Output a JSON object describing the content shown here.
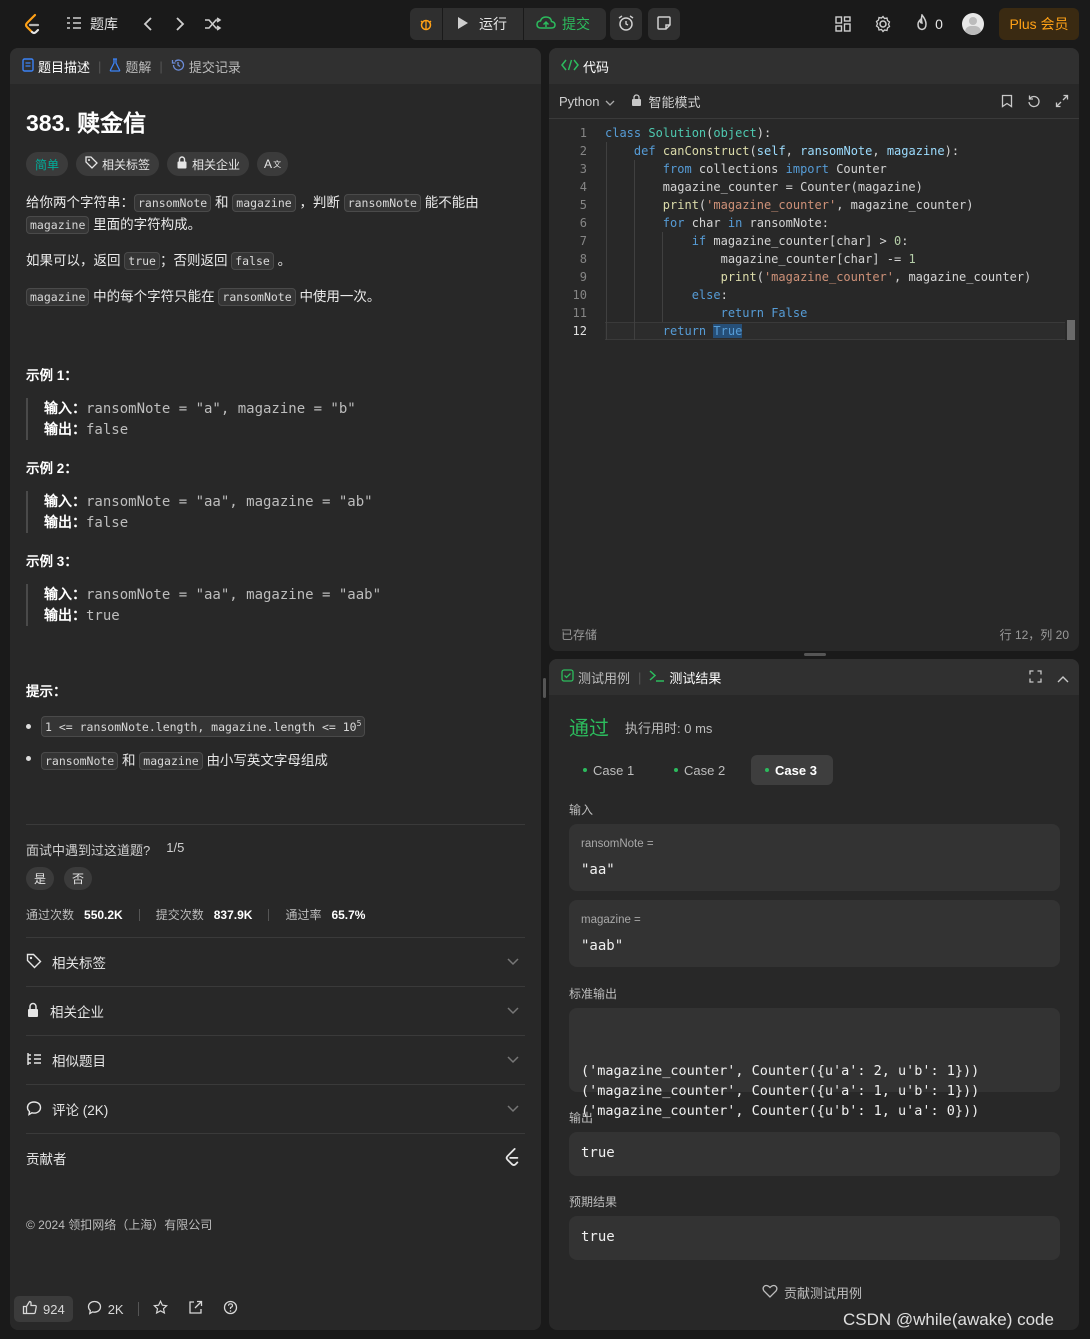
{
  "topbar": {
    "problem_list": "题库",
    "run": "运行",
    "submit": "提交",
    "streak": "0",
    "plus": "Plus 会员"
  },
  "left": {
    "tabs": {
      "desc": "题目描述",
      "solution": "题解",
      "submissions": "提交记录"
    },
    "title": "383. 赎金信",
    "tags": {
      "difficulty": "简单",
      "topics": "相关标签",
      "companies": "相关企业",
      "translate": "A"
    },
    "desc": {
      "l1a": "给你两个字符串：",
      "c1": "ransomNote",
      "l1b": "和",
      "c2": "magazine",
      "l1c": "，判断",
      "c3": "ransomNote",
      "l1d": "能不能由",
      "c4": "magazine",
      "l1e": "里面的字符构成。",
      "l2a": "如果可以，返回",
      "c5": "true",
      "l2b": "；否则返回",
      "c6": "false",
      "l2c": "。",
      "c7": "magazine",
      "l3a": "中的每个字符只能在",
      "c8": "ransomNote",
      "l3b": "中使用一次。"
    },
    "examples": [
      {
        "title": "示例 1：",
        "in_label": "输入：",
        "input": "ransomNote = \"a\", magazine = \"b\"",
        "out_label": "输出：",
        "output": "false"
      },
      {
        "title": "示例 2：",
        "in_label": "输入：",
        "input": "ransomNote = \"aa\", magazine = \"ab\"",
        "out_label": "输出：",
        "output": "false"
      },
      {
        "title": "示例 3：",
        "in_label": "输入：",
        "input": "ransomNote = \"aa\", magazine = \"aab\"",
        "out_label": "输出：",
        "output": "true"
      }
    ],
    "hints_title": "提示：",
    "hints": {
      "h1": "1 <= ransomNote.length, magazine.length <= 10",
      "h1_sup": "5",
      "h2a": "ransomNote",
      "h2b": "和",
      "h2c": "magazine",
      "h2d": "由小写英文字母组成"
    },
    "interview": {
      "q": "面试中遇到过这道题?",
      "count": "1/5",
      "yes": "是",
      "no": "否"
    },
    "stats": {
      "accepted_label": "通过次数",
      "accepted": "550.2K",
      "submitted_label": "提交次数",
      "submitted": "837.9K",
      "rate_label": "通过率",
      "rate": "65.7%"
    },
    "accordion": {
      "topics": "相关标签",
      "companies": "相关企业",
      "similar": "相似题目",
      "comments": "评论 (2K)",
      "contributors": "贡献者"
    },
    "copyright": "© 2024 领扣网络（上海）有限公司",
    "footer": {
      "likes": "924",
      "comments": "2K"
    }
  },
  "editor": {
    "tab": "代码",
    "lang": "Python",
    "mode": "智能模式",
    "saved": "已存储",
    "cursor": "行 12，列 20",
    "lines": [
      "1",
      "2",
      "3",
      "4",
      "5",
      "6",
      "7",
      "8",
      "9",
      "10",
      "11",
      "12"
    ]
  },
  "result": {
    "tab_cases": "测试用例",
    "tab_result": "测试结果",
    "status": "通过",
    "runtime": "执行用时: 0 ms",
    "cases": [
      "Case 1",
      "Case 2",
      "Case 3"
    ],
    "input_label": "输入",
    "var1_name": "ransomNote =",
    "var1_value": "\"aa\"",
    "var2_name": "magazine =",
    "var2_value": "\"aab\"",
    "stdout_label": "标准输出",
    "stdout": [
      "('magazine_counter', Counter({u'a': 2, u'b': 1}))",
      "('magazine_counter', Counter({u'a': 1, u'b': 1}))",
      "('magazine_counter', Counter({u'b': 1, u'a': 0}))"
    ],
    "output_label": "输出",
    "output": "true",
    "expected_label": "预期结果",
    "expected": "true",
    "contribute": "贡献测试用例"
  },
  "watermark": "CSDN @while(awake) code",
  "colors": {
    "accent_green": "#2cbb5d",
    "plus_orange": "#ffa116",
    "easy_teal": "#00af9b"
  }
}
